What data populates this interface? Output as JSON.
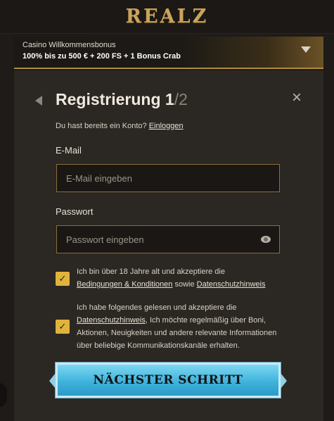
{
  "brand": {
    "logo_text": "REALZ"
  },
  "bonus": {
    "kicker": "Casino Willkommensbonus",
    "offer": "100% bis zu 500 € + 200 FS + 1 Bonus Crab"
  },
  "form": {
    "title": "Registrierung",
    "step_current": "1",
    "step_total": "/2",
    "login_prompt": "Du hast bereits ein Konto?",
    "login_link": "Einloggen",
    "email": {
      "label": "E-Mail",
      "placeholder": "E-Mail eingeben",
      "value": ""
    },
    "password": {
      "label": "Passwort",
      "placeholder": "Passwort eingeben",
      "value": ""
    },
    "consent_age": {
      "checked": true,
      "text_1": "Ich bin über 18 Jahre alt und akzeptiere die",
      "link_terms": "Bedingungen & Konditionen",
      "text_2": "sowie",
      "link_privacy": "Datenschutzhinweis"
    },
    "consent_marketing": {
      "checked": true,
      "text_1": "Ich habe folgendes gelesen und akzeptiere die",
      "link_privacy": "Datenschutzhinweis",
      "text_2": ", Ich möchte regelmäßig über Boni, Aktionen, Neuigkeiten und andere relevante Informationen über beliebige Kommunikationskanäle erhalten."
    },
    "next_button": "NÄCHSTER SCHRITT"
  },
  "icons": {
    "back": "chevron-left-icon",
    "close": "close-icon",
    "dropdown": "chevron-down-icon",
    "eye": "eye-icon",
    "check": "checkmark-icon"
  },
  "colors": {
    "accent_gold": "#e0b33a",
    "button_blue": "#3fb3dc",
    "card_bg": "#2b2722",
    "page_bg": "#1e1b18"
  }
}
